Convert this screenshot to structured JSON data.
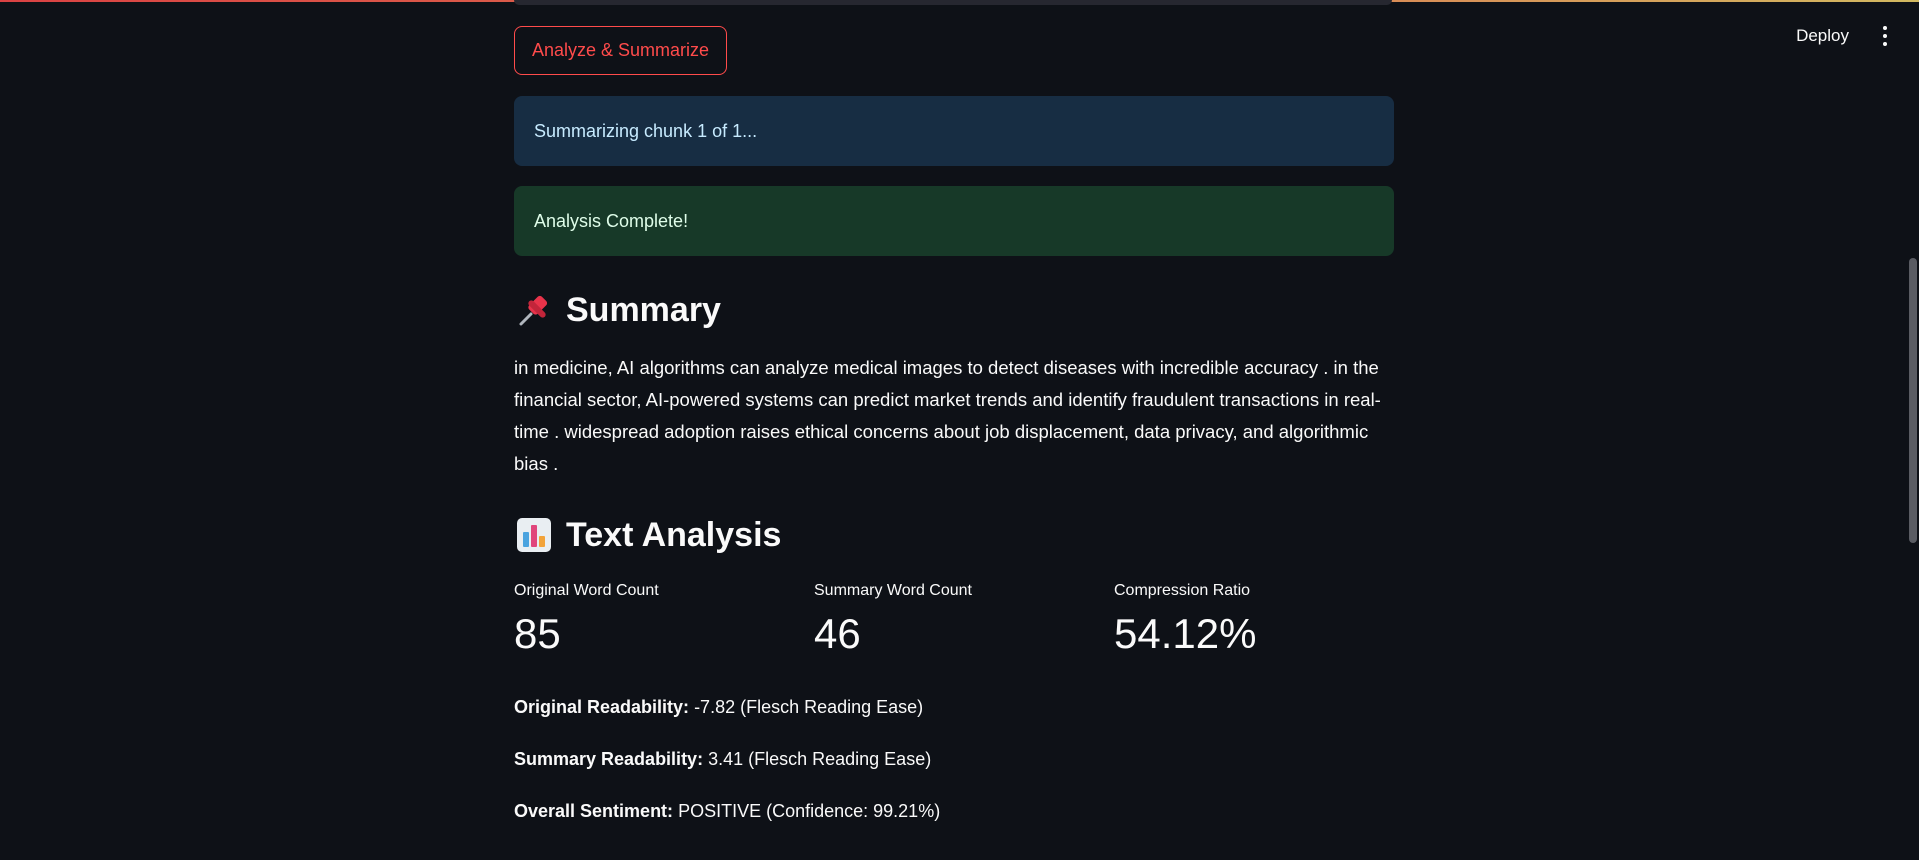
{
  "header": {
    "deploy_label": "Deploy"
  },
  "actions": {
    "analyze_label": "Analyze & Summarize"
  },
  "alerts": {
    "info": "Summarizing chunk 1 of 1...",
    "success": "Analysis Complete!"
  },
  "summary": {
    "heading": "Summary",
    "icon": "pushpin-icon",
    "text": "in medicine, AI algorithms can analyze medical images to detect diseases with incredible accuracy . in the financial sector, AI-powered systems can predict market trends and identify fraudulent transactions in real-time . widespread adoption raises ethical concerns about job displacement, data privacy, and algorithmic bias ."
  },
  "analysis": {
    "heading": "Text Analysis",
    "icon": "bar-chart-icon",
    "metrics": [
      {
        "label": "Original Word Count",
        "value": "85"
      },
      {
        "label": "Summary Word Count",
        "value": "46"
      },
      {
        "label": "Compression Ratio",
        "value": "54.12%"
      }
    ],
    "stats": [
      {
        "label": "Original Readability:",
        "value": "-7.82 (Flesch Reading Ease)"
      },
      {
        "label": "Summary Readability:",
        "value": "3.41 (Flesch Reading Ease)"
      },
      {
        "label": "Overall Sentiment:",
        "value": "POSITIVE (Confidence: 99.21%)"
      }
    ]
  },
  "colors": {
    "background": "#0e1117",
    "primary": "#ff4b4b",
    "info_bg": "#172d43",
    "success_bg": "#173928"
  }
}
